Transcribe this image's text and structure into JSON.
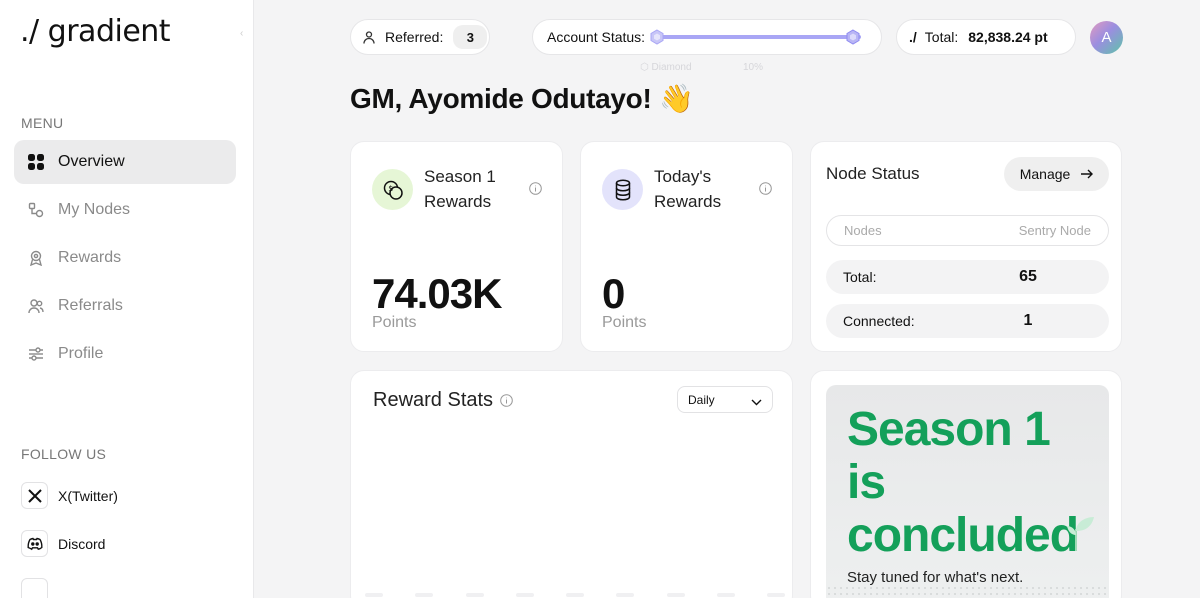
{
  "app": {
    "logo": "./ gradient"
  },
  "sidebar": {
    "menu_label": "MENU",
    "items": [
      {
        "label": "Overview",
        "icon": "grid-icon",
        "active": true
      },
      {
        "label": "My Nodes",
        "icon": "nodes-icon",
        "active": false
      },
      {
        "label": "Rewards",
        "icon": "award-icon",
        "active": false
      },
      {
        "label": "Referrals",
        "icon": "users-icon",
        "active": false
      },
      {
        "label": "Profile",
        "icon": "sliders-icon",
        "active": false
      }
    ],
    "follow_label": "FOLLOW US",
    "social": [
      {
        "label": "X(Twitter)",
        "icon": "x-twitter-icon"
      },
      {
        "label": "Discord",
        "icon": "discord-icon"
      }
    ]
  },
  "topbar": {
    "referred_label": "Referred:",
    "referred_count": "3",
    "status_label": "Account Status:",
    "total_label": "Total:",
    "total_value": "82,838.24 pt",
    "total_logo": "./",
    "avatar_initial": "A"
  },
  "tooltip_ghost": {
    "tier": "Diamond",
    "pct": "10%"
  },
  "greeting": "GM, Ayomide Odutayo! 👋",
  "cards": {
    "season": {
      "title_line1": "Season 1",
      "title_line2": "Rewards",
      "value": "74.03K",
      "unit": "Points"
    },
    "today": {
      "title_line1": "Today's",
      "title_line2": "Rewards",
      "value": "0",
      "unit": "Points"
    }
  },
  "node_status": {
    "title": "Node Status",
    "manage_label": "Manage",
    "tab_nodes": "Nodes",
    "tab_sentry": "Sentry Node",
    "rows": [
      {
        "label": "Total:",
        "value": "65"
      },
      {
        "label": "Connected:",
        "value": "1"
      }
    ]
  },
  "reward_stats": {
    "title": "Reward Stats",
    "period": "Daily"
  },
  "promo": {
    "line1": "Season 1",
    "line2": "is",
    "line3": "concluded",
    "subtitle": "Stay tuned for what's next."
  },
  "colors": {
    "accent_green": "#14a05a",
    "track": "#a9a6f5",
    "season_badge": "#e6f6d6",
    "today_badge": "#e3e3fb"
  }
}
